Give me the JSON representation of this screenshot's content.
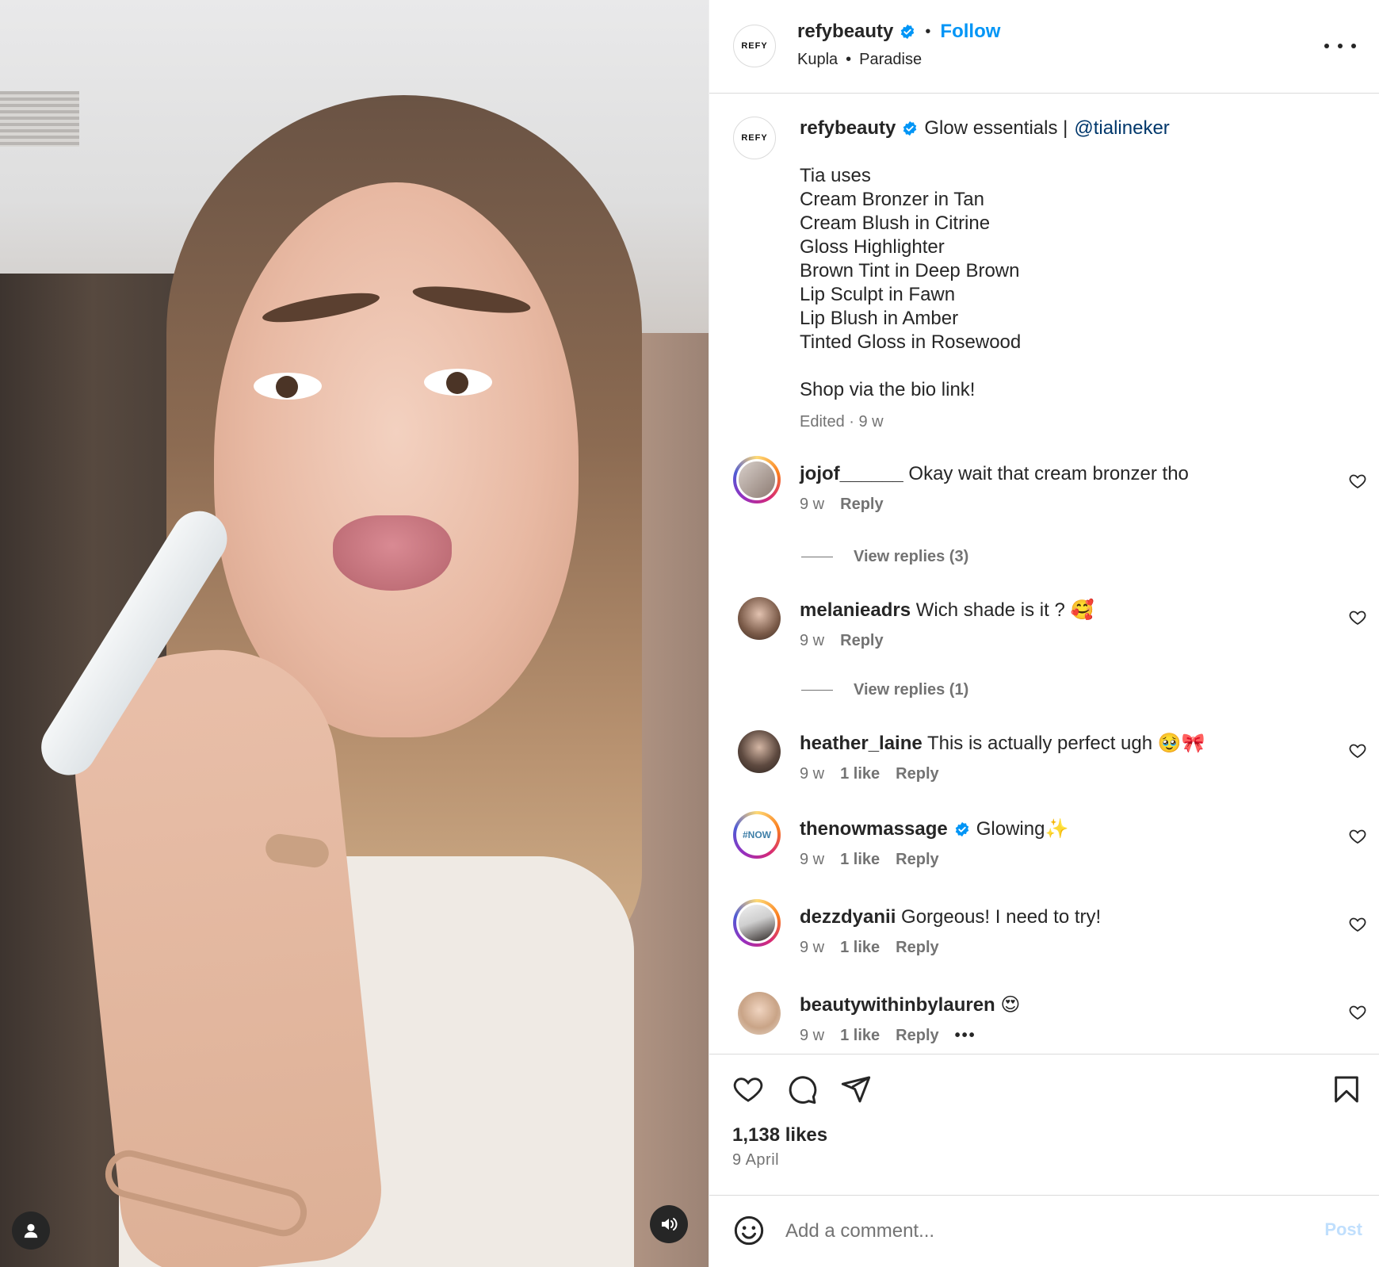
{
  "colors": {
    "link": "#0095f6",
    "mention": "#00376b",
    "muted": "#737373",
    "text": "#262626",
    "verified": "#0095f6",
    "post_disabled": "#c0dffd"
  },
  "header": {
    "username": "refybeauty",
    "follow": "Follow",
    "audio_artist": "Kupla",
    "audio_title": "Paradise",
    "avatar_text": "REFY"
  },
  "caption": {
    "username": "refybeauty",
    "headline": "Glow essentials |",
    "mention": "@tialineker",
    "lines": [
      "Tia uses",
      "Cream Bronzer in Tan",
      "Cream Blush in Citrine",
      "Gloss Highlighter",
      "Brown Tint in Deep Brown",
      "Lip Sculpt in Fawn",
      "Lip Blush in Amber",
      "Tinted Gloss in Rosewood"
    ],
    "shop": "Shop via the bio link!",
    "meta": "Edited · 9 w"
  },
  "comments": [
    {
      "username": "jojof______",
      "text": "Okay wait that cream bronzer tho",
      "time": "9 w",
      "likes": "",
      "reply": "Reply",
      "view_replies": "View replies (3)"
    },
    {
      "username": "melanieadrs",
      "text": "Wich shade is it ? 🥰",
      "time": "9 w",
      "likes": "",
      "reply": "Reply",
      "view_replies": "View replies (1)"
    },
    {
      "username": "heather_laine",
      "text": "This is actually perfect ugh 🥹🎀",
      "time": "9 w",
      "likes": "1 like",
      "reply": "Reply"
    },
    {
      "username": "thenowmassage",
      "text": "Glowing✨",
      "time": "9 w",
      "likes": "1 like",
      "reply": "Reply",
      "avatar_text": "#NOW"
    },
    {
      "username": "dezzdyanii",
      "text": "Gorgeous! I need to try!",
      "time": "9 w",
      "likes": "1 like",
      "reply": "Reply"
    },
    {
      "username": "beautywithinbylauren",
      "text": "😍",
      "time": "9 w",
      "likes": "1 like",
      "reply": "Reply",
      "more": "•••"
    }
  ],
  "actions": {
    "likes": "1,138 likes",
    "date": "9 April"
  },
  "add_comment": {
    "placeholder": "Add a comment...",
    "post": "Post"
  },
  "icons": [
    "user-icon",
    "audio-icon",
    "verified-icon",
    "more-icon",
    "heart-icon",
    "comment-icon",
    "share-icon",
    "bookmark-icon",
    "emoji-icon"
  ]
}
